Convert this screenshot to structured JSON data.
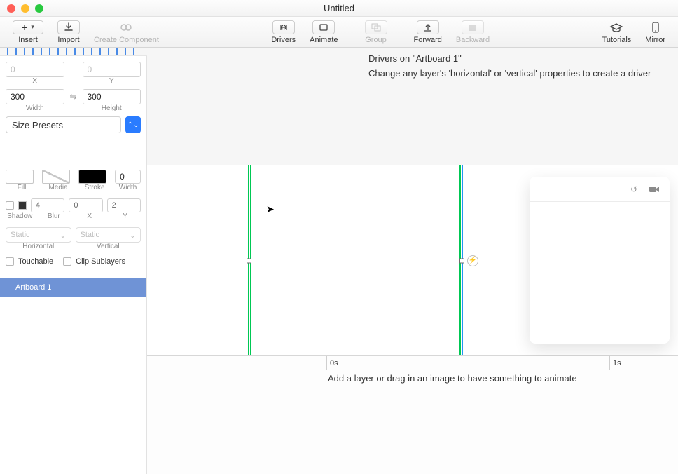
{
  "window": {
    "title": "Untitled"
  },
  "toolbar": {
    "insert": "Insert",
    "import": "Import",
    "create_component": "Create Component",
    "drivers": "Drivers",
    "animate": "Animate",
    "group": "Group",
    "forward": "Forward",
    "backward": "Backward",
    "tutorials": "Tutorials",
    "mirror": "Mirror"
  },
  "inspector": {
    "x_placeholder": "0",
    "y_placeholder": "0",
    "x_label": "X",
    "y_label": "Y",
    "width_value": "300",
    "height_value": "300",
    "width_label": "Width",
    "height_label": "Height",
    "size_presets": "Size Presets",
    "fill_label": "Fill",
    "media_label": "Media",
    "stroke_label": "Stroke",
    "stroke_width_label": "Width",
    "stroke_width_value": "0",
    "shadow_label": "Shadow",
    "blur_label": "Blur",
    "shadow_x_label": "X",
    "shadow_y_label": "Y",
    "blur_value": "4",
    "shadow_x_value": "0",
    "shadow_y_value": "2",
    "horizontal_mode": "Static",
    "vertical_mode": "Static",
    "horizontal_label": "Horizontal",
    "vertical_label": "Vertical",
    "touchable": "Touchable",
    "clip_sublayers": "Clip Sublayers"
  },
  "layers": {
    "selected": "Artboard 1"
  },
  "drivers_panel": {
    "title": "Drivers on \"Artboard 1\"",
    "hint": "Change any layer's 'horizontal' or 'vertical' properties to create a driver"
  },
  "timeline": {
    "t0": "0s",
    "t1": "1s",
    "empty_hint": "Add a layer or drag in an image to have something to animate"
  }
}
